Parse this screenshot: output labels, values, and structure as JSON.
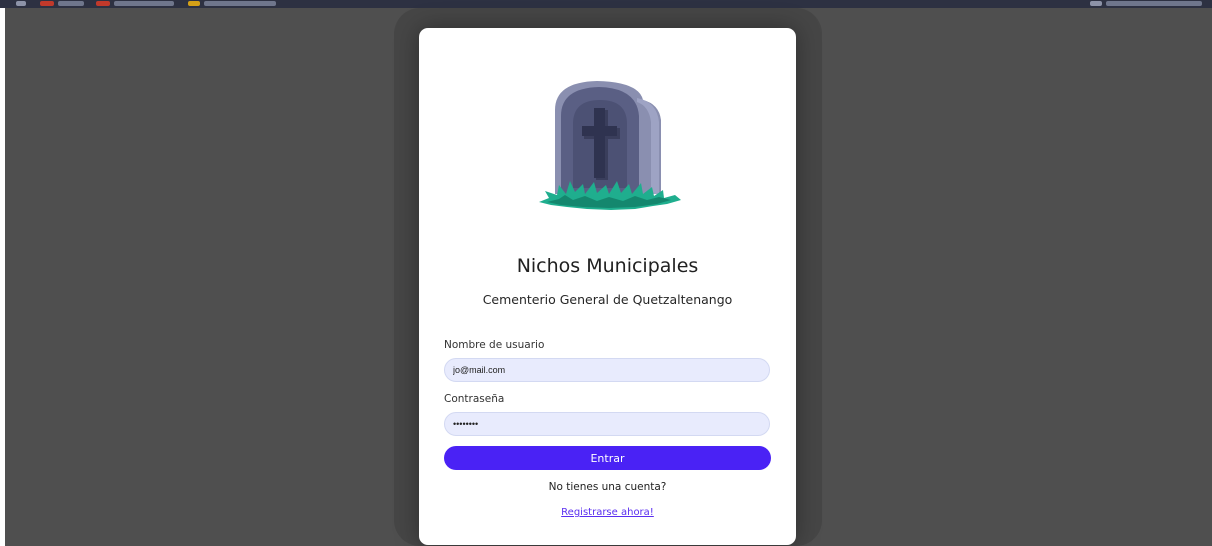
{
  "app": {
    "title": "Nichos Municipales",
    "subtitle": "Cementerio General de Quetzaltenango",
    "logo_icon": "tombstone-icon"
  },
  "form": {
    "username_label": "Nombre de usuario",
    "username_value": "jo@mail.com",
    "password_label": "Contraseña",
    "password_value": "12345678",
    "submit_label": "Entrar"
  },
  "footer": {
    "question": "No tienes una cuenta?",
    "register_link": "Registrarse ahora!"
  },
  "colors": {
    "primary": "#4a22f5",
    "link": "#5a2ef0",
    "input_bg": "#e8ebfd",
    "backdrop": "#4f4f4f",
    "grass": "#1fae8e",
    "stone": "#5a5f84"
  }
}
